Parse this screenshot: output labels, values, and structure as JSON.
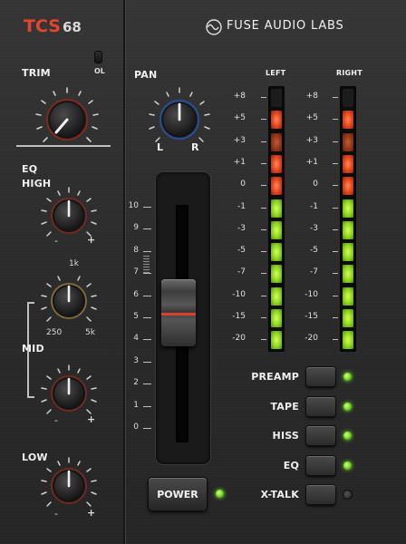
{
  "brand": {
    "name_red": "TCS",
    "name_num": "68",
    "company": "FUSE AUDIO LABS"
  },
  "controls": {
    "trim": {
      "label": "TRIM"
    },
    "ol": {
      "label": "OL",
      "state": "off"
    },
    "eq": {
      "label": "EQ"
    },
    "high": {
      "label": "HIGH",
      "minus": "-",
      "plus": "+"
    },
    "mid_freq": {
      "top": "1k",
      "left": "250",
      "right": "5k"
    },
    "mid": {
      "label": "MID",
      "minus": "-",
      "plus": "+"
    },
    "low": {
      "label": "LOW",
      "minus": "-",
      "plus": "+"
    },
    "pan": {
      "label": "PAN",
      "left": "L",
      "right": "R"
    }
  },
  "fader": {
    "scale": [
      "10",
      "9",
      "8",
      "7",
      "6",
      "5",
      "4",
      "3",
      "2",
      "1",
      "0"
    ]
  },
  "meters": {
    "left_label": "LEFT",
    "right_label": "RIGHT",
    "scale": [
      "+8",
      "+5",
      "+3",
      "+1",
      "0",
      "-1",
      "-3",
      "-5",
      "-7",
      "-10",
      "-15",
      "-20"
    ]
  },
  "switches": [
    {
      "label": "PREAMP",
      "led": "on"
    },
    {
      "label": "TAPE",
      "led": "on"
    },
    {
      "label": "HISS",
      "led": "on"
    },
    {
      "label": "EQ",
      "led": "on"
    },
    {
      "label": "X-TALK",
      "led": "off"
    }
  ],
  "power": {
    "label": "POWER",
    "led": "on"
  },
  "icons": {
    "logo": "fuse-logo-icon"
  }
}
